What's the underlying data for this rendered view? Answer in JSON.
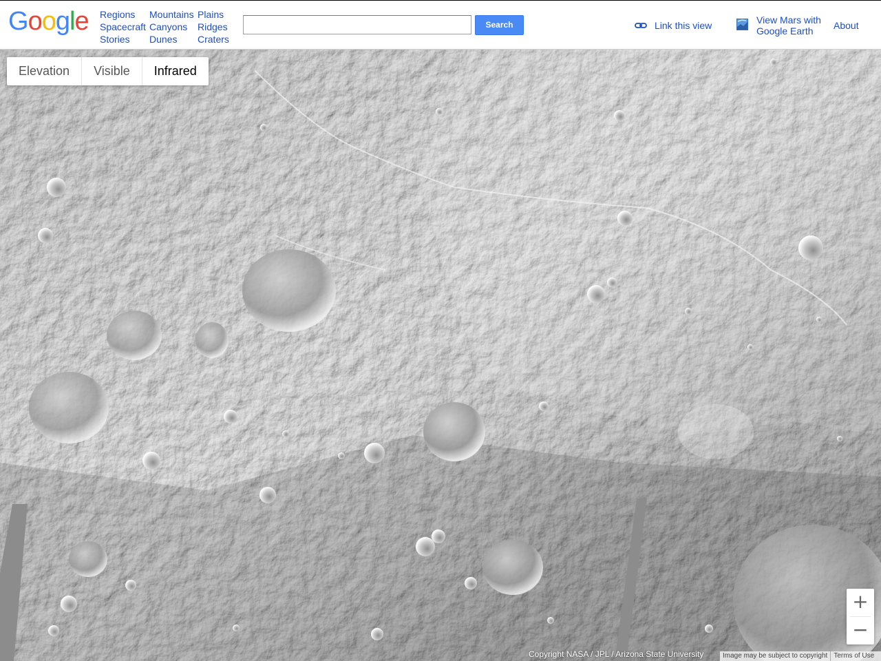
{
  "header": {
    "logo_letters": [
      {
        "char": "G",
        "color": "#4285F4"
      },
      {
        "char": "o",
        "color": "#EA4335"
      },
      {
        "char": "o",
        "color": "#FBBC05"
      },
      {
        "char": "g",
        "color": "#4285F4"
      },
      {
        "char": "l",
        "color": "#34A853"
      },
      {
        "char": "e",
        "color": "#EA4335"
      }
    ],
    "nav": {
      "regions": "Regions",
      "mountains": "Mountains",
      "plains": "Plains",
      "spacecraft": "Spacecraft",
      "canyons": "Canyons",
      "ridges": "Ridges",
      "stories": "Stories",
      "dunes": "Dunes",
      "craters": "Craters"
    },
    "search": {
      "value": "",
      "placeholder": "",
      "button_label": "Search"
    },
    "link_view_label": "Link this view",
    "earth_label": "View Mars with Google Earth",
    "about_label": "About"
  },
  "layers": {
    "elevation": "Elevation",
    "visible": "Visible",
    "infrared": "Infrared",
    "active": "Infrared"
  },
  "zoom": {
    "in_label": "+",
    "out_label": "−"
  },
  "footer": {
    "copyright": "Copyright NASA / JPL / Arizona State University",
    "copyright_notice": "Image may be subject to copyright",
    "terms_label": "Terms of Use"
  },
  "colors": {
    "link": "#1a4fc9",
    "search_button": "#4a8af4"
  }
}
